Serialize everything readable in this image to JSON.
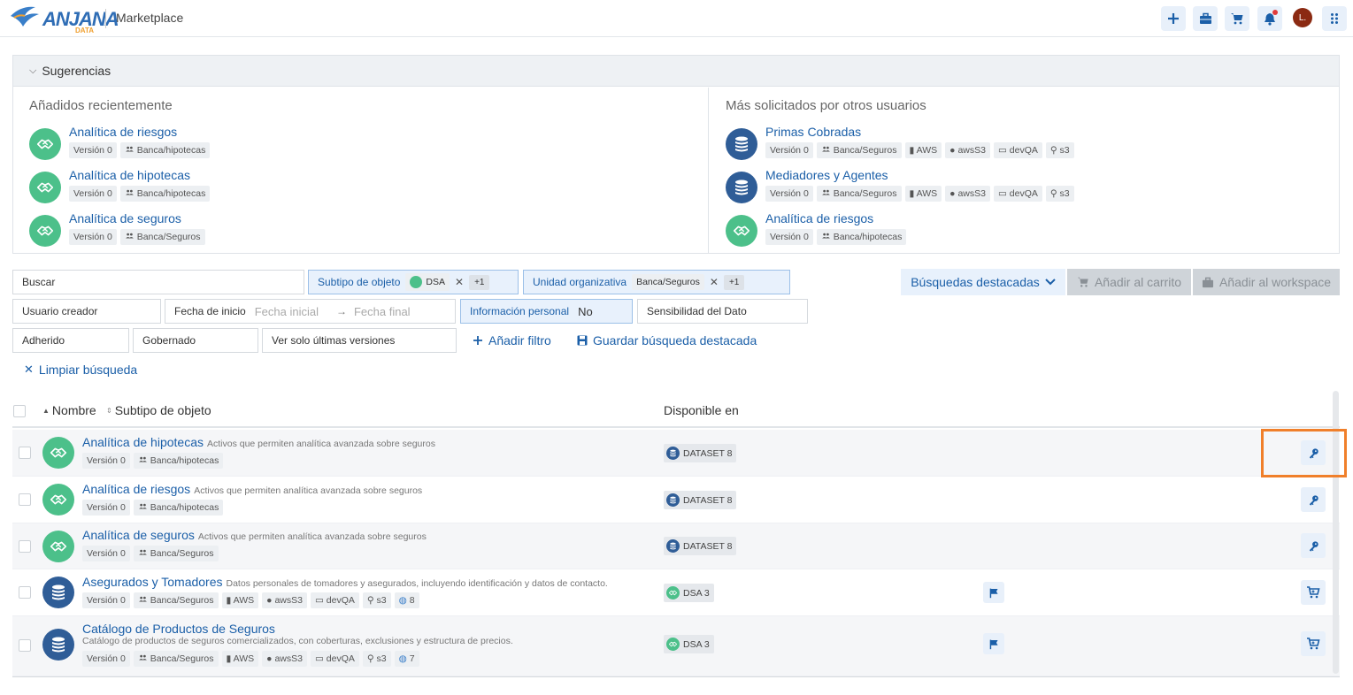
{
  "header": {
    "logo_text": "ANJANA",
    "logo_sub": "DATA",
    "app_title": "Marketplace",
    "avatar_initial": "L."
  },
  "suggestions": {
    "title": "Sugerencias",
    "recent_title": "Añadidos recientemente",
    "popular_title": "Más solicitados por otros usuarios",
    "recent": [
      {
        "name": "Analítica de riesgos",
        "version": "Versión 0",
        "org": "Banca/hipotecas"
      },
      {
        "name": "Analítica de hipotecas",
        "version": "Versión 0",
        "org": "Banca/hipotecas"
      },
      {
        "name": "Analítica de seguros",
        "version": "Versión 0",
        "org": "Banca/Seguros"
      }
    ],
    "popular": [
      {
        "name": "Primas Cobradas",
        "version": "Versión 0",
        "org": "Banca/Seguros",
        "t1": "AWS",
        "t2": "awsS3",
        "t3": "devQA",
        "t4": "s3"
      },
      {
        "name": "Mediadores y Agentes",
        "version": "Versión 0",
        "org": "Banca/Seguros",
        "t1": "AWS",
        "t2": "awsS3",
        "t3": "devQA",
        "t4": "s3"
      },
      {
        "name": "Analítica de riesgos",
        "version": "Versión 0",
        "org": "Banca/hipotecas"
      }
    ]
  },
  "filters": {
    "search": "Buscar",
    "subtype_label": "Subtipo de objeto",
    "subtype_value": "DSA",
    "subtype_more": "+1",
    "org_label": "Unidad organizativa",
    "org_value": "Banca/Seguros",
    "org_more": "+1",
    "creator": "Usuario creador",
    "start_label": "Fecha de inicio",
    "start_placeholder": "Fecha inicial",
    "end_placeholder": "Fecha final",
    "personal_label": "Información personal",
    "personal_value": "No",
    "sensitivity": "Sensibilidad del Dato",
    "adherido": "Adherido",
    "gobernado": "Gobernado",
    "latest": "Ver solo últimas versiones",
    "add_filter": "Añadir filtro",
    "save_search": "Guardar búsqueda destacada",
    "clear": "Limpiar búsqueda",
    "featured": "Búsquedas destacadas",
    "add_cart": "Añadir al carrito",
    "add_workspace": "Añadir al workspace"
  },
  "table": {
    "col_name": "Nombre",
    "col_subtype": "Subtipo de objeto",
    "col_available": "Disponible en",
    "rows": [
      {
        "name": "Analítica de hipotecas",
        "desc": "Activos que permiten analítica avanzada sobre seguros",
        "version": "Versión 0",
        "org": "Banca/hipotecas",
        "avail": "DATASET 8"
      },
      {
        "name": "Analítica de riesgos",
        "desc": "Activos que permiten analítica avanzada sobre seguros",
        "version": "Versión 0",
        "org": "Banca/hipotecas",
        "avail": "DATASET 8"
      },
      {
        "name": "Analítica de seguros",
        "desc": "Activos que permiten analítica avanzada sobre seguros",
        "version": "Versión 0",
        "org": "Banca/Seguros",
        "avail": "DATASET 8"
      },
      {
        "name": "Asegurados y Tomadores",
        "desc": "Datos personales de tomadores y asegurados, incluyendo identificación y datos de contacto.",
        "version": "Versión 0",
        "org": "Banca/Seguros",
        "t1": "AWS",
        "t2": "awsS3",
        "t3": "devQA",
        "t4": "s3",
        "t5": "8",
        "avail": "DSA 3"
      },
      {
        "name": "Catálogo de Productos de Seguros",
        "desc": "Catálogo de productos de seguros comercializados, con coberturas, exclusiones y estructura de precios.",
        "version": "Versión 0",
        "org": "Banca/Seguros",
        "t1": "AWS",
        "t2": "awsS3",
        "t3": "devQA",
        "t4": "s3",
        "t5": "7",
        "avail": "DSA 3"
      }
    ]
  },
  "colors": {
    "accent": "#1b5fa8",
    "green_icon": "#4cc08a",
    "blue_icon": "#2f5d97",
    "highlight": "#f07f2a"
  }
}
